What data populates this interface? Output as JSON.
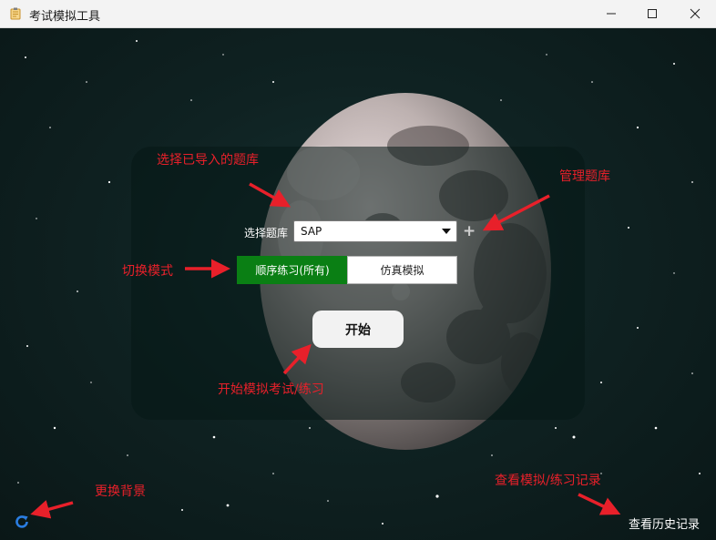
{
  "window": {
    "title": "考试模拟工具",
    "icon": "notepad-icon"
  },
  "form": {
    "library_label": "选择题库",
    "library_selected": "SAP",
    "add_library_symbol": "+"
  },
  "modes": {
    "sequential_label": "顺序练习(所有)",
    "simulation_label": "仿真模拟",
    "active": "sequential"
  },
  "start": {
    "label": "开始"
  },
  "footer": {
    "history_label": "查看历史记录",
    "refresh_icon": "refresh-icon"
  },
  "annotations": {
    "select_library": "选择已导入的题库",
    "manage_library": "管理题库",
    "switch_mode": "切换模式",
    "start_hint": "开始模拟考试/练习",
    "change_background": "更换背景",
    "view_records": "查看模拟/练习记录"
  },
  "colors": {
    "accent_green": "#0a7f14",
    "annotation_red": "#e8202a",
    "refresh_blue": "#2a7de1"
  }
}
